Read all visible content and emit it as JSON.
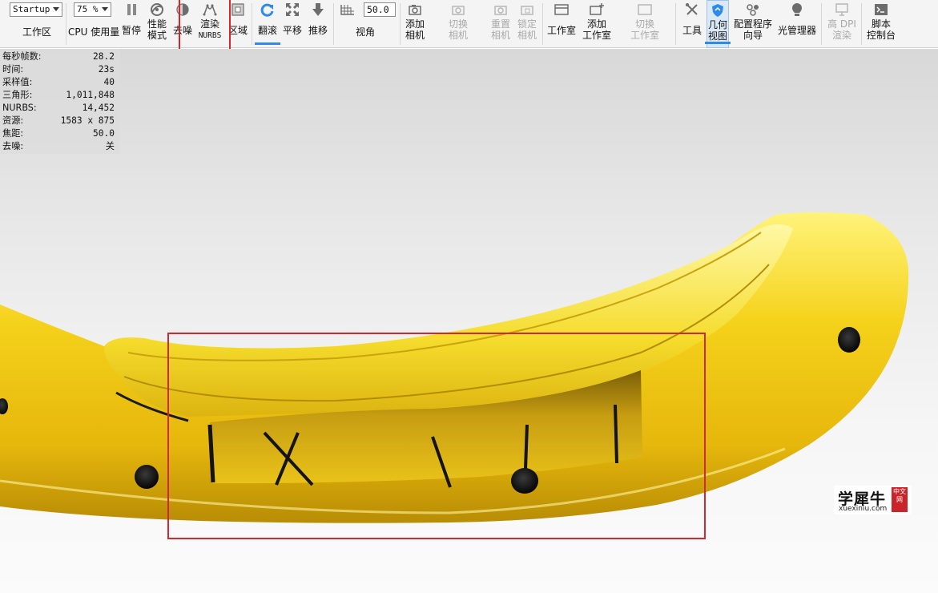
{
  "toolbar": {
    "workspace": {
      "select_value": "Startup",
      "label": "工作区"
    },
    "cpu": {
      "select_value": "75 %",
      "label": "CPU 使用量"
    },
    "pause": {
      "label": "暂停"
    },
    "performance": {
      "label": "性能\n模式"
    },
    "denoise": {
      "label": "去噪"
    },
    "render_nurbs": {
      "label": "渲染",
      "sub": "NURBS"
    },
    "region": {
      "label": "区域"
    },
    "tumble": {
      "label": "翻滚"
    },
    "pan": {
      "label": "平移"
    },
    "dolly": {
      "label": "推移"
    },
    "fov": {
      "value": "50.0",
      "label": "视角"
    },
    "add_camera": {
      "label": "添加\n相机"
    },
    "switch_camera": {
      "label": "切换\n相机"
    },
    "reset_camera": {
      "label": "重置\n相机"
    },
    "lock_camera": {
      "label": "锁定\n相机"
    },
    "studio": {
      "label": "工作室"
    },
    "add_studio": {
      "label": "添加\n工作室"
    },
    "switch_studio": {
      "label": "切换\n工作室"
    },
    "tools": {
      "label": "工具"
    },
    "geometry_view": {
      "label": "几何\n视图"
    },
    "configurator": {
      "label": "配置程序\n向导"
    },
    "light_manager": {
      "label": "光管理器"
    },
    "hdpi": {
      "label": "高 DPI\n渲染"
    },
    "script_console": {
      "label": "脚本\n控制台"
    }
  },
  "stats": [
    {
      "key": "每秒帧数:",
      "value": "28.2"
    },
    {
      "key": "时间:",
      "value": "23s"
    },
    {
      "key": "采样值:",
      "value": "40"
    },
    {
      "key": "三角形:",
      "value": "1,011,848"
    },
    {
      "key": "NURBS:",
      "value": "14,452"
    },
    {
      "key": "资源:",
      "value": "1583 x 875"
    },
    {
      "key": "焦距:",
      "value": "50.0"
    },
    {
      "key": "去噪:",
      "value": "关"
    }
  ],
  "watermark": {
    "title": "学犀牛",
    "url": "xuexiniu.com",
    "seal": "中文网"
  },
  "colors": {
    "accent": "#2e8be8",
    "highlight_box": "#d6262f",
    "model_yellow": "#f0d21c"
  },
  "icons": [
    "pause-icon",
    "performance-icon",
    "denoise-icon",
    "nurbs-icon",
    "region-icon",
    "tumble-icon",
    "pan-icon",
    "dolly-icon",
    "viewport-grid-icon",
    "camera-icon",
    "studio-icon",
    "tools-icon",
    "shield-icon",
    "configurator-icon",
    "light-bulb-icon",
    "monitor-icon",
    "console-icon"
  ]
}
